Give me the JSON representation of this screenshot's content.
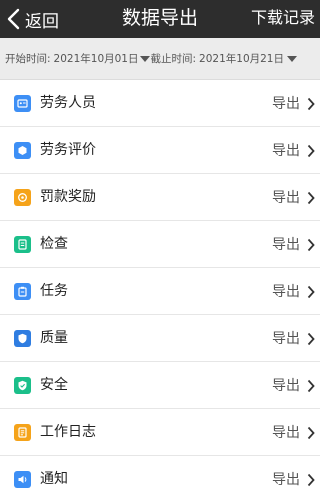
{
  "header": {
    "back_label": "返回",
    "title": "数据导出",
    "download_label": "下载记录"
  },
  "filter": {
    "start_label": "开始时间:",
    "start_value": "2021年10月01日",
    "end_label": "截止时间:",
    "end_value": "2021年10月21日"
  },
  "items": [
    {
      "label": "劳务人员",
      "action": "导出",
      "icon": "id-card-icon",
      "color": "#3d8ff5"
    },
    {
      "label": "劳务评价",
      "action": "导出",
      "icon": "badge-icon",
      "color": "#3d8ff5"
    },
    {
      "label": "罚款奖励",
      "action": "导出",
      "icon": "reward-icon",
      "color": "#f5a31a"
    },
    {
      "label": "检查",
      "action": "导出",
      "icon": "check-doc-icon",
      "color": "#1bbf8a"
    },
    {
      "label": "任务",
      "action": "导出",
      "icon": "clipboard-icon",
      "color": "#3d8ff5"
    },
    {
      "label": "质量",
      "action": "导出",
      "icon": "quality-shield-icon",
      "color": "#2f7de1"
    },
    {
      "label": "安全",
      "action": "导出",
      "icon": "safety-shield-icon",
      "color": "#1bbf8a"
    },
    {
      "label": "工作日志",
      "action": "导出",
      "icon": "log-book-icon",
      "color": "#f5a31a"
    },
    {
      "label": "通知",
      "action": "导出",
      "icon": "speaker-icon",
      "color": "#3d8ff5"
    }
  ]
}
